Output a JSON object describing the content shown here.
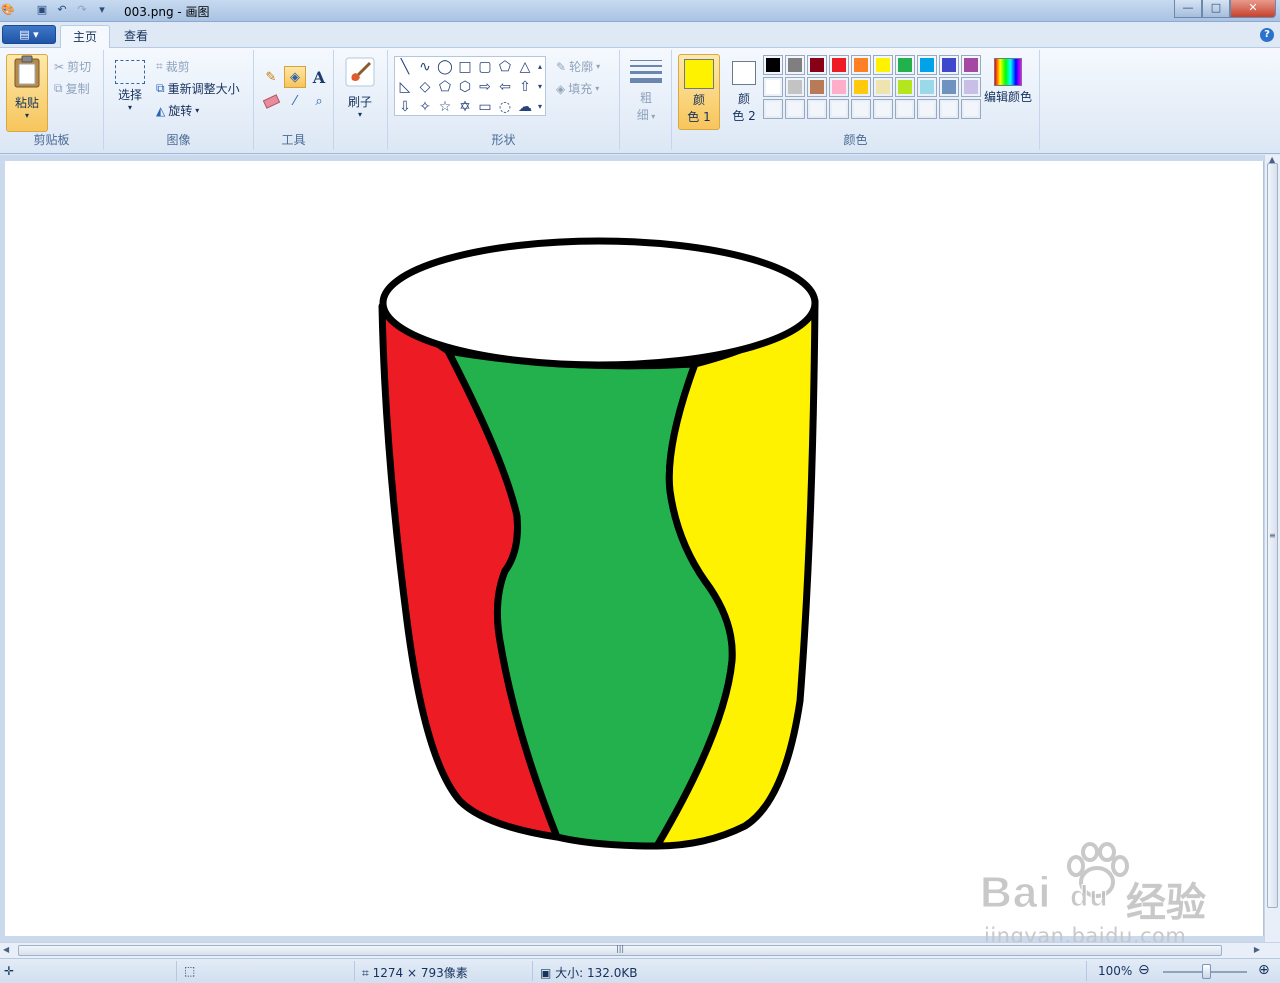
{
  "window": {
    "title": "003.png - 画图",
    "min": "—",
    "max": "□",
    "close": "✕"
  },
  "tabs": [
    {
      "label": "主页"
    },
    {
      "label": "查看"
    }
  ],
  "help": "?",
  "clipboard": {
    "paste": "粘贴",
    "cut": "剪切",
    "copy": "复制",
    "group": "剪贴板"
  },
  "image": {
    "select": "选择",
    "crop": "裁剪",
    "resize": "重新调整大小",
    "rotate": "旋转",
    "group": "图像"
  },
  "tools": {
    "group": "工具",
    "text_tool": "A"
  },
  "brushes": {
    "label": "刷子"
  },
  "shapes": {
    "outline": "轮廓",
    "fill": "填充",
    "group": "形状"
  },
  "size": {
    "line1": "粗",
    "line2": "细"
  },
  "colors": {
    "color1_line1": "颜",
    "color1_line2": "色 1",
    "color2_line1": "颜",
    "color2_line2": "色 2",
    "edit": "编辑颜色",
    "group": "颜色",
    "color1_value": "#fff200",
    "color2_value": "#ffffff",
    "palette_row1": [
      "#000000",
      "#7f7f7f",
      "#880015",
      "#ed1c24",
      "#ff7f27",
      "#fff200",
      "#22b14c",
      "#00a2e8",
      "#3f48cc",
      "#a349a4"
    ],
    "palette_row2": [
      "#ffffff",
      "#c3c3c3",
      "#b97a57",
      "#ffaec9",
      "#ffc90e",
      "#efe4b0",
      "#b5e61d",
      "#99d9ea",
      "#7092be",
      "#c8bfe7"
    ]
  },
  "drawing": {
    "left_stripe": "#ed1c24",
    "middle_stripe": "#22b14c",
    "right_stripe": "#fff200",
    "outline": "#000000"
  },
  "watermark": {
    "brand": "Bai",
    "brand_du": "du",
    "brand_cn": "经验",
    "url": "jingyan.baidu.com"
  },
  "status": {
    "dimensions": "1274 × 793像素",
    "filesize": "大小: 132.0KB",
    "zoom": "100%"
  }
}
